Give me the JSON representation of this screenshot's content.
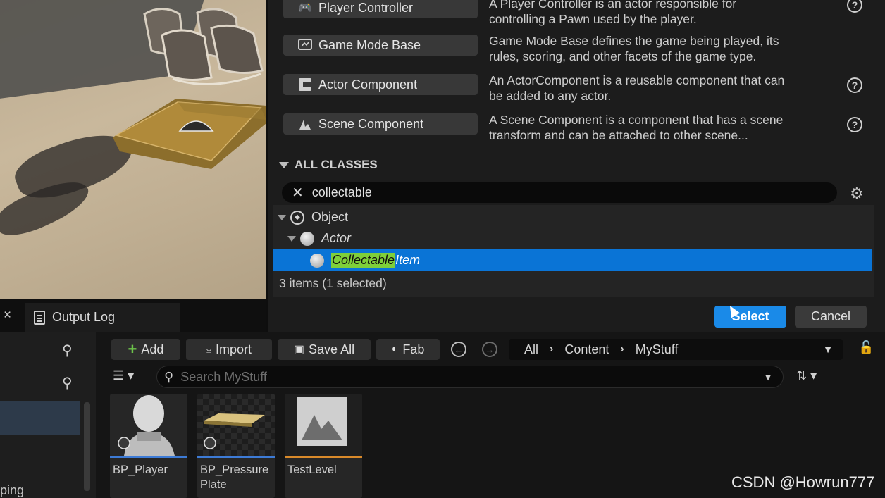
{
  "common_classes": [
    {
      "label": "Player Controller",
      "icon": "gamepad-icon",
      "description_line1": "A Player Controller is an actor responsible for",
      "description_line2": "controlling a Pawn used by the player."
    },
    {
      "label": "Game Mode Base",
      "icon": "game-mode-icon",
      "description_line1": "Game Mode Base defines the game being played, its",
      "description_line2": "rules, scoring, and other facets of the game type."
    },
    {
      "label": "Actor Component",
      "icon": "component-icon",
      "description_line1": "An ActorComponent is a reusable component that can",
      "description_line2": "be added to any actor."
    },
    {
      "label": "Scene Component",
      "icon": "scene-component-icon",
      "description_line1": "A Scene Component is a component that has a scene",
      "description_line2": "transform and can be attached to other scene..."
    }
  ],
  "all_classes": {
    "header": "ALL CLASSES",
    "search_value": "collectable",
    "tree": {
      "object": "Object",
      "actor": "Actor",
      "item_match": "Collectable",
      "item_rest": "Item"
    },
    "status": "3 items (1 selected)"
  },
  "dialog_buttons": {
    "select": "Select",
    "cancel": "Cancel"
  },
  "bottom_tabs": {
    "close": "×",
    "output_log": "Output Log"
  },
  "toolbar": {
    "add": "Add",
    "import": "Import",
    "save_all": "Save All",
    "fab": "Fab"
  },
  "breadcrumb": [
    "All",
    "Content",
    "MyStuff"
  ],
  "content_search": {
    "placeholder": "Search MyStuff"
  },
  "assets": [
    {
      "name": "BP_Player",
      "bar_color": "#3d7bd6"
    },
    {
      "name": "BP_Pressure Plate",
      "bar_color": "#3d7bd6"
    },
    {
      "name": "TestLevel",
      "bar_color": "#d98a2a"
    }
  ],
  "left_panel": {
    "partial_text": "ping"
  },
  "watermark": "CSDN @Howrun777"
}
